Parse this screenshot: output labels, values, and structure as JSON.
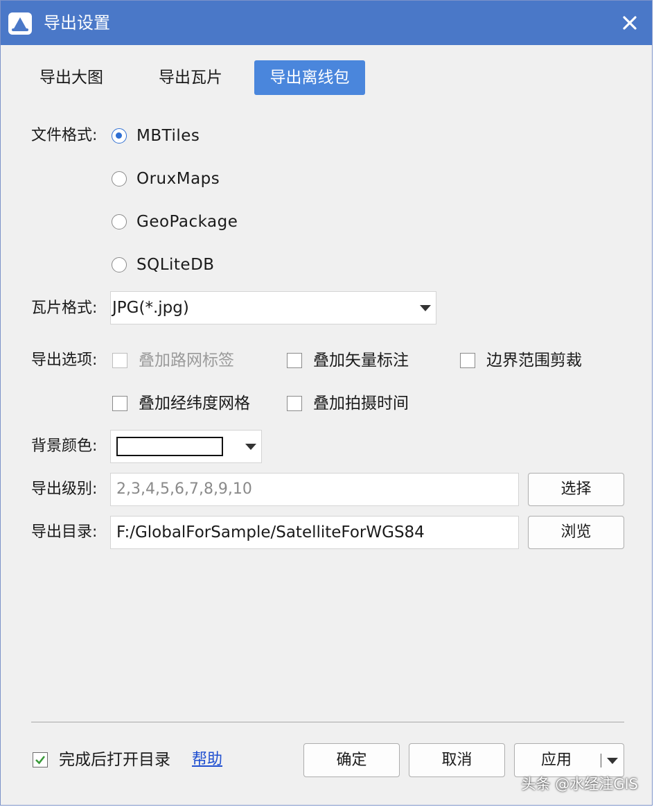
{
  "window": {
    "title": "导出设置"
  },
  "tabs": [
    {
      "label": "导出大图"
    },
    {
      "label": "导出瓦片"
    },
    {
      "label": "导出离线包"
    }
  ],
  "file_format": {
    "label": "文件格式:",
    "options": [
      "MBTiles",
      "OruxMaps",
      "GeoPackage",
      "SQLiteDB"
    ],
    "selected": "MBTiles"
  },
  "tile_format": {
    "label": "瓦片格式:",
    "value": "JPG(*.jpg)"
  },
  "export_options": {
    "label": "导出选项:",
    "items": [
      {
        "label": "叠加路网标签",
        "checked": false,
        "disabled": true
      },
      {
        "label": "叠加矢量标注",
        "checked": false,
        "disabled": false
      },
      {
        "label": "边界范围剪裁",
        "checked": false,
        "disabled": false
      },
      {
        "label": "叠加经纬度网格",
        "checked": false,
        "disabled": false
      },
      {
        "label": "叠加拍摄时间",
        "checked": false,
        "disabled": false
      }
    ]
  },
  "background_color": {
    "label": "背景颜色:",
    "value_color": "#ffffff"
  },
  "export_level": {
    "label": "导出级别:",
    "value": "2,3,4,5,6,7,8,9,10",
    "button": "选择"
  },
  "export_dir": {
    "label": "导出目录:",
    "value": "F:/GlobalForSample/SatelliteForWGS84",
    "button": "浏览"
  },
  "footer": {
    "open_after": {
      "label": "完成后打开目录",
      "checked": true
    },
    "help": "帮助",
    "ok": "确定",
    "cancel": "取消",
    "apply": "应用"
  },
  "watermark": "头条 @水经注GIS",
  "colors": {
    "titlebar": "#4a78c8",
    "active_tab": "#4a86dc",
    "radio_selected": "#2f6fd2",
    "link": "#1f4fd0",
    "check": "#3a9a3a"
  }
}
